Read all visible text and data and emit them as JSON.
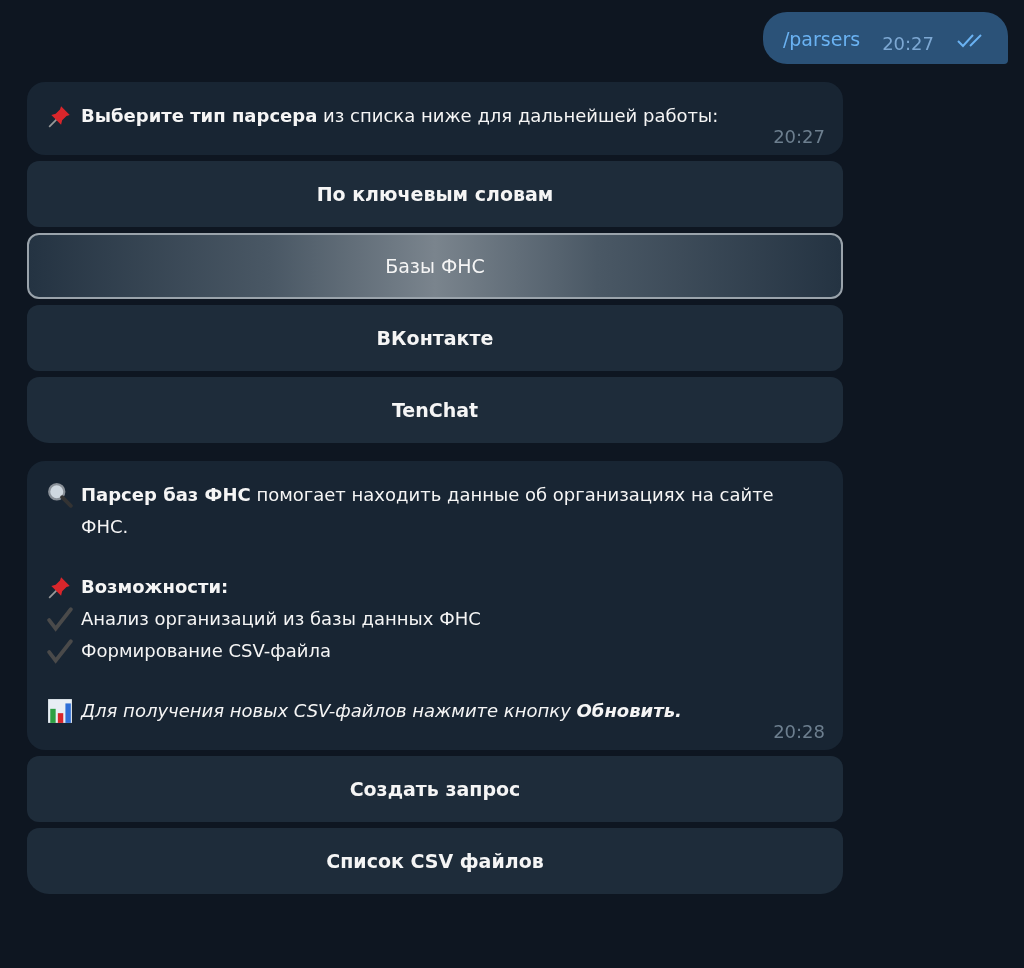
{
  "outgoing": {
    "text": "/parsers",
    "time": "20:27",
    "read": true
  },
  "messages": [
    {
      "paragraphs": [
        [
          {
            "kind": "pin",
            "italic": false,
            "text": "**Выберите тип парсера** из списка ниже для дальнейшей работы:"
          }
        ]
      ],
      "time": "20:27",
      "buttons": [
        {
          "label": "По ключевым словам",
          "selected": false
        },
        {
          "label": "Базы ФНС",
          "selected": true
        },
        {
          "label": "ВКонтакте",
          "selected": false
        },
        {
          "label": "TenChat",
          "selected": false
        }
      ]
    },
    {
      "paragraphs": [
        [
          {
            "kind": "magnifier",
            "italic": false,
            "text": "**Парсер баз ФНС** помогает находить данные об организациях на сайте ФНС."
          }
        ],
        [
          {
            "kind": "pin",
            "italic": false,
            "text": "**Возможности:**"
          },
          {
            "kind": "check",
            "italic": false,
            "text": "Анализ организаций из базы данных ФНС"
          },
          {
            "kind": "check",
            "italic": false,
            "text": "Формирование CSV-файла"
          }
        ],
        [
          {
            "kind": "chart",
            "italic": true,
            "text": "Для получения новых CSV-файлов нажмите кнопку **Обновить.**"
          }
        ]
      ],
      "time": "20:28",
      "buttons": [
        {
          "label": "Создать запрос",
          "selected": false
        },
        {
          "label": "Список CSV файлов",
          "selected": false
        }
      ]
    }
  ]
}
